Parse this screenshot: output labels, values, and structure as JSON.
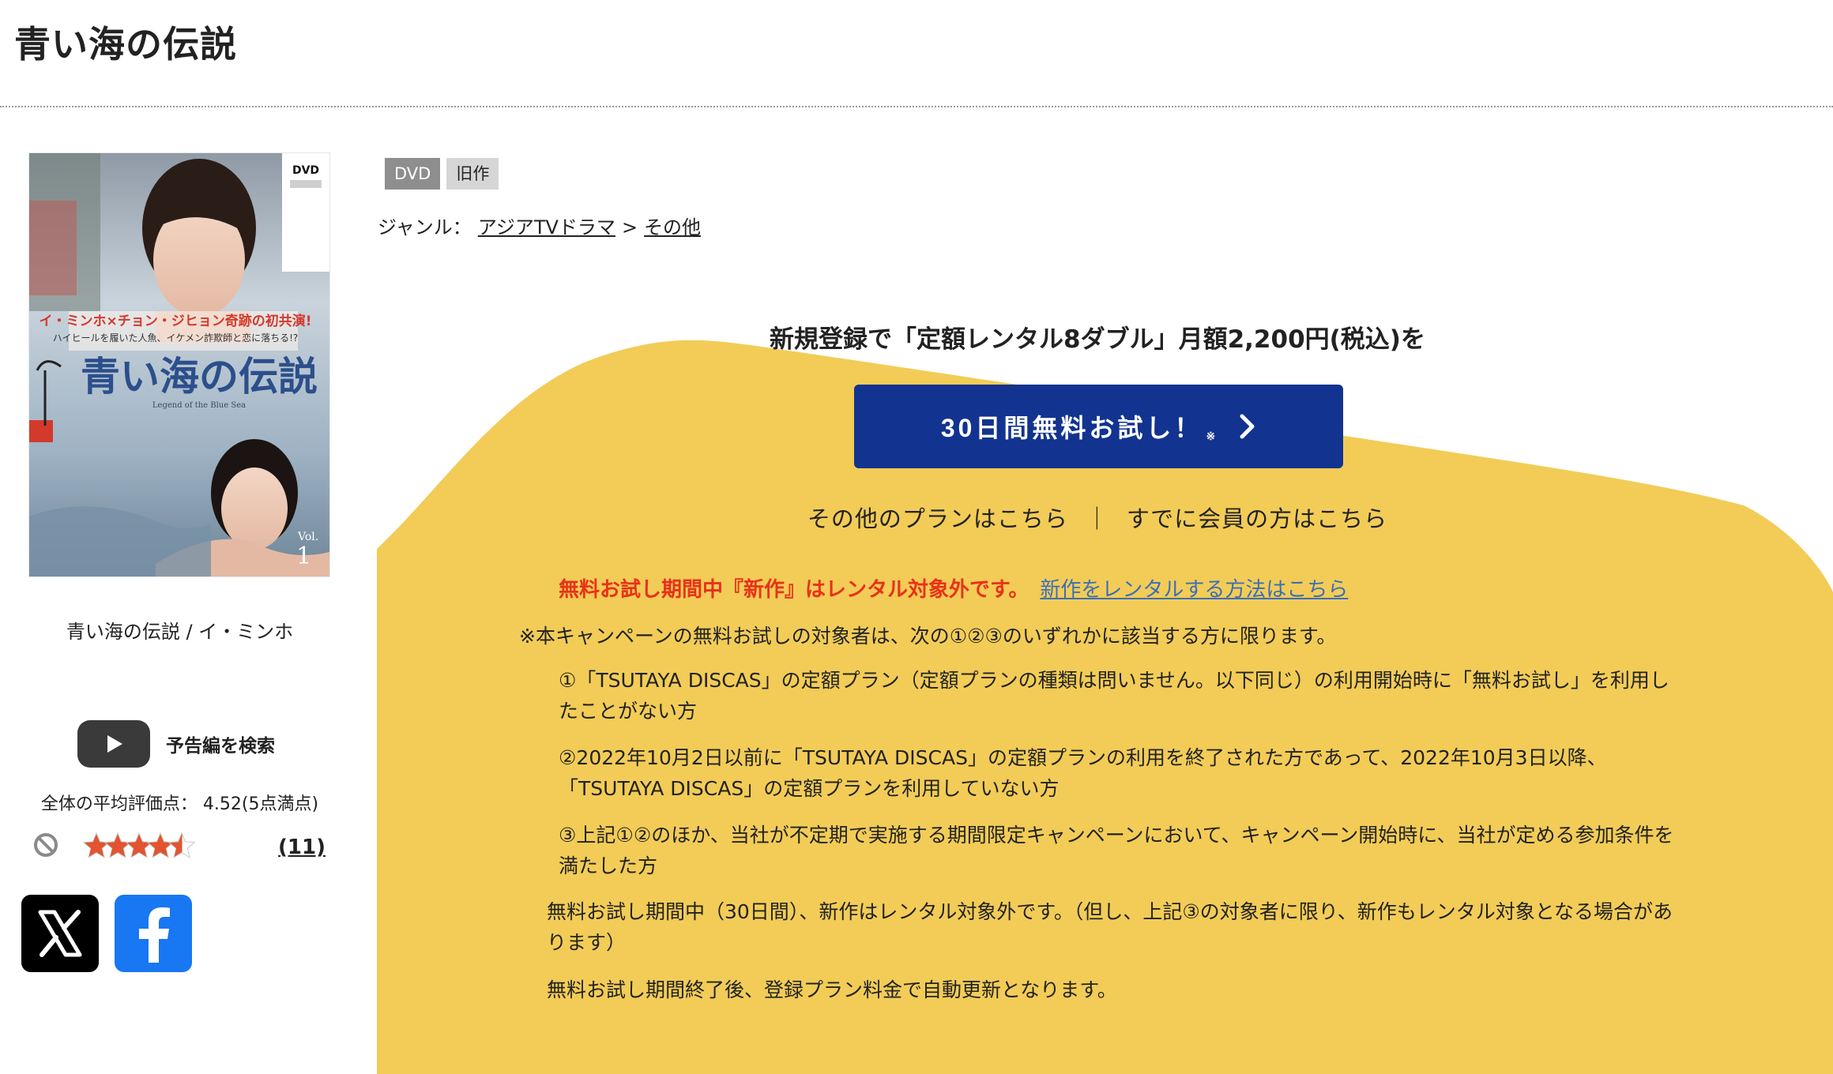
{
  "header": {
    "title": "青い海の伝説"
  },
  "product": {
    "cover_alt": "青い海の伝説 DVD cover",
    "caption": "青い海の伝説 / イ・ミンホ",
    "badges": [
      "DVD",
      "旧作"
    ],
    "genre": {
      "label": "ジャンル：",
      "path": [
        {
          "label": "アジアTVドラマ"
        },
        {
          "label": "その他"
        }
      ],
      "separator": ">"
    }
  },
  "trailer": {
    "label": "予告編を検索",
    "icon": "youtube-play-icon"
  },
  "rating": {
    "text": "全体の平均評価点： 4.52(5点満点)",
    "stars": 4.52,
    "max": 5,
    "count_label": "(11)",
    "star_color": "#e2542f"
  },
  "share": {
    "x_icon": "x-logo-icon",
    "facebook_icon": "facebook-logo-icon"
  },
  "campaign": {
    "headline": "新規登録で「定額レンタル8ダブル」月額2,200円(税込)を",
    "button_label": "30日間無料お試し！",
    "button_mark": "※",
    "other_plans": "その他のプランはこちら",
    "link_separator": "｜",
    "member_login": "すでに会員の方はこちら",
    "warning": "無料お試し期間中『新作』はレンタル対象外です。",
    "warning_link": "新作をレンタルする方法はこちら",
    "note": "※本キャンペーンの無料お試しの対象者は、次の①②③のいずれかに該当する方に限ります。",
    "conditions": [
      "①「TSUTAYA DISCAS」の定額プラン（定額プランの種類は問いません。以下同じ）の利用開始時に「無料お試し」を利用したことがない方",
      "②2022年10月2日以前に「TSUTAYA DISCAS」の定額プランの利用を終了された方であって、2022年10月3日以降、「TSUTAYA DISCAS」の定額プランを利用していない方",
      "③上記①②のほか、当社が不定期で実施する期間限定キャンペーンにおいて、キャンペーン開始時に、当社が定める参加条件を満たした方"
    ],
    "trial_notice": "無料お試し期間中（30日間）、新作はレンタル対象外です。（但し、上記③の対象者に限り、新作もレンタル対象となる場合があります）",
    "renewal": "無料お試し期間終了後、登録プラン料金で自動更新となります。"
  },
  "colors": {
    "promo_yellow": "#f2cc57",
    "button_blue": "#12338f",
    "warning_red": "#e8321a",
    "link_blue": "#3d6fb6"
  }
}
